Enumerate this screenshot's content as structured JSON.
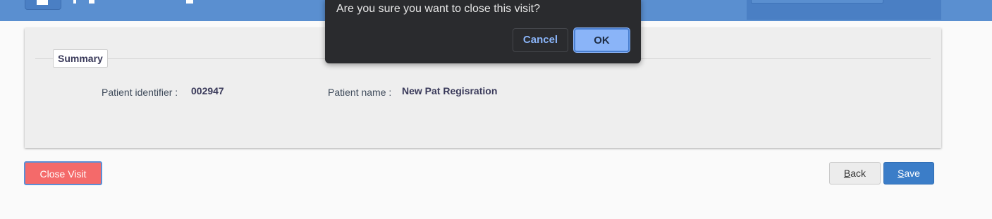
{
  "dialog": {
    "message": "Are you sure you want to close this visit?",
    "cancel_label": "Cancel",
    "ok_label": "OK"
  },
  "summary": {
    "legend": "Summary",
    "patient_identifier_label": "Patient identifier :",
    "patient_identifier_value": "002947",
    "patient_name_label": "Patient name :",
    "patient_name_value": "New Pat Regisration"
  },
  "actions": {
    "close_visit_label": "Close Visit",
    "back_key": "B",
    "back_rest": "ack",
    "save_key": "S",
    "save_rest": "ave"
  },
  "colors": {
    "header": "#5a8fd0",
    "close_visit": "#f46a6a",
    "save": "#3b7dc8",
    "dialog_bg": "#2a2b2e",
    "dialog_ok": "#8ab4f8"
  }
}
